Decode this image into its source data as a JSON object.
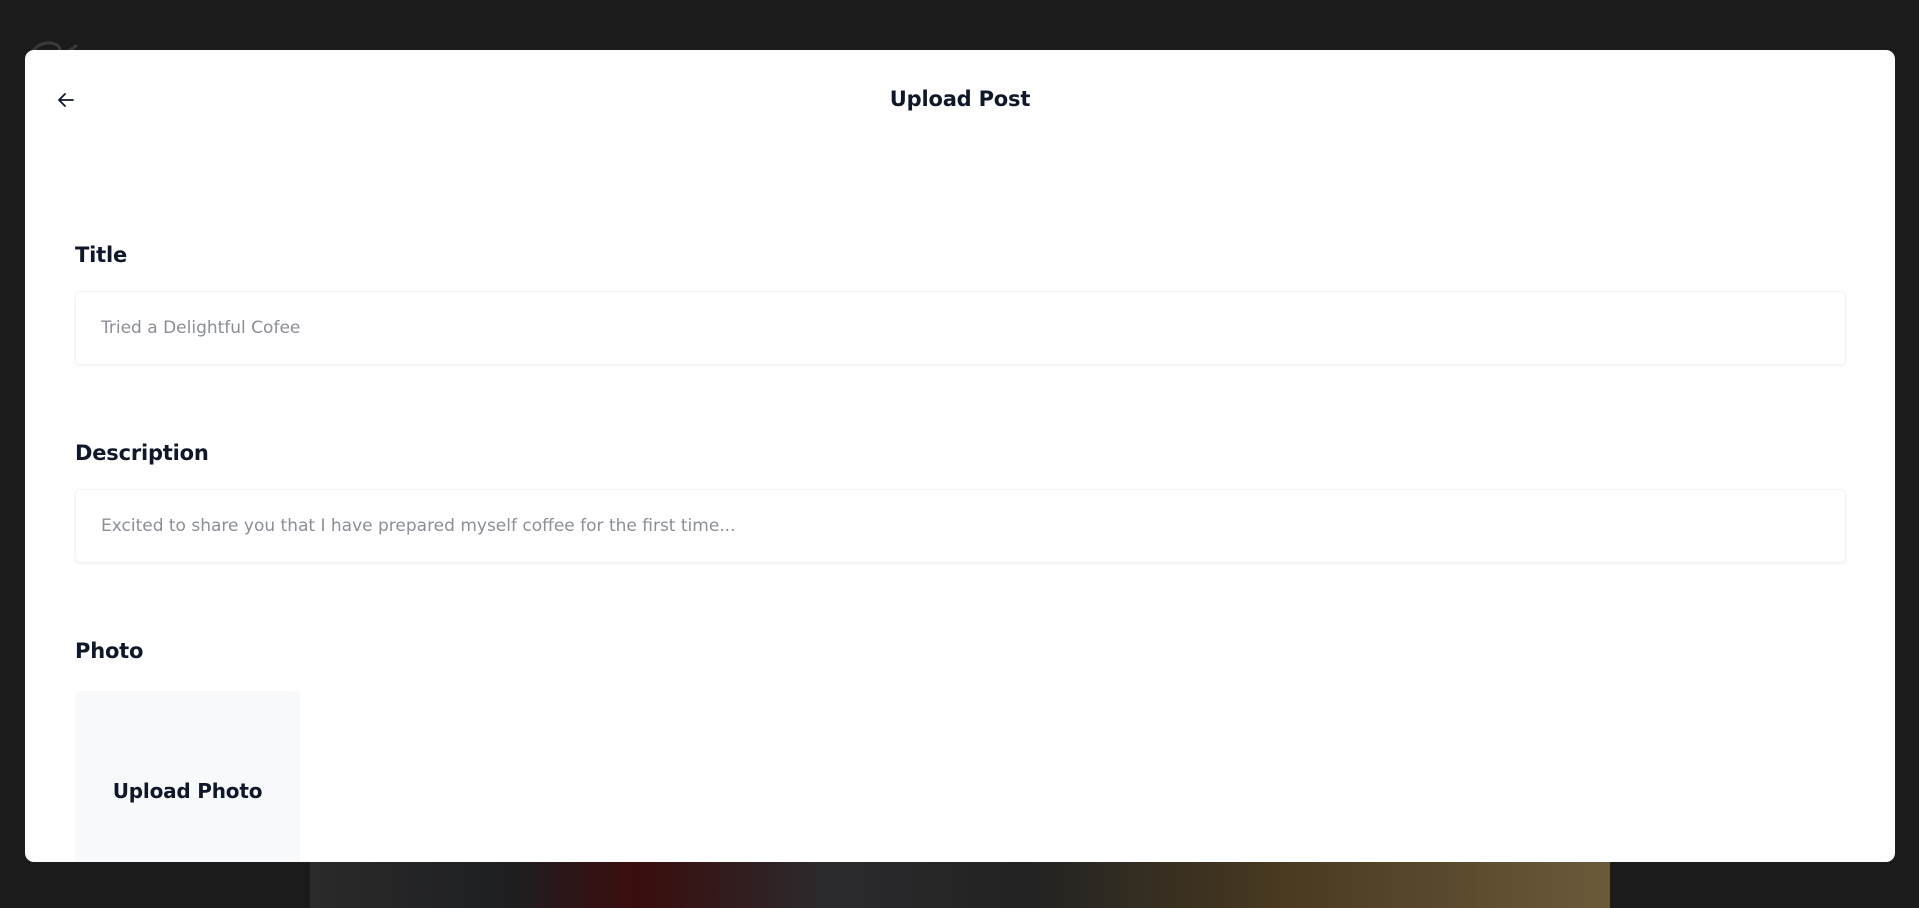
{
  "modal": {
    "title": "Upload Post"
  },
  "form": {
    "title_label": "Title",
    "title_placeholder": "Tried a Delightful Cofee",
    "description_label": "Description",
    "description_placeholder": "Excited to share you that I have prepared myself coffee for the first time...",
    "photo_label": "Photo",
    "upload_photo_label": "Upload Photo"
  },
  "icons": {
    "back": "arrow-left-icon",
    "background_logo": "logo-icon"
  },
  "colors": {
    "backdrop": "#1b1b1b",
    "modal_bg": "#ffffff",
    "text_primary": "#0f172a",
    "placeholder": "#8b8f97",
    "upload_box_bg": "#f8f9fb"
  }
}
